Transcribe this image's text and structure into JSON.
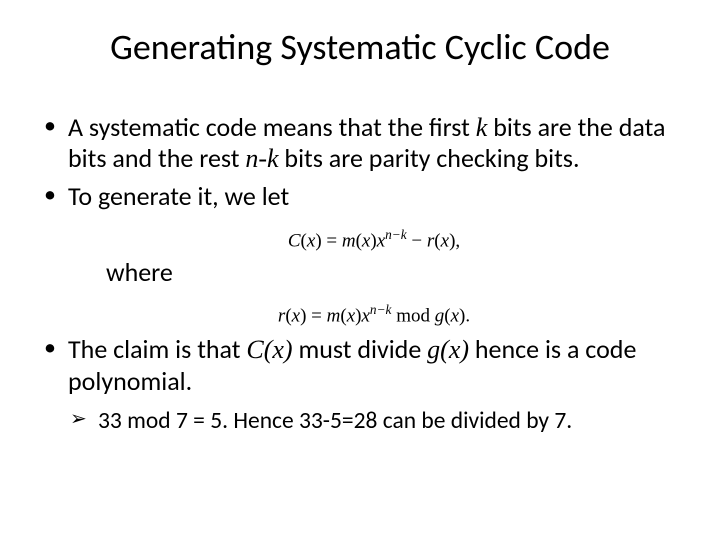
{
  "title": "Generating Systematic Cyclic Code",
  "bullets": {
    "b1_pre": "A systematic code means that the first ",
    "b1_k": "k",
    "b1_mid": " bits are the data bits and the rest ",
    "b1_nk": "n-k",
    "b1_post": " bits are parity checking bits.",
    "b2": "To generate it, we let",
    "b3_pre": "The claim is that ",
    "b3_cx": "C(x)",
    "b3_mid": " must divide ",
    "b3_gx": "g(x)",
    "b3_post": " hence is a code polynomial."
  },
  "eq1": {
    "lhs_var": "C",
    "lhs_arg": "x",
    "eq": " = ",
    "m": "m",
    "xarg": "x",
    "xbase": "x",
    "exp1": "n",
    "exp_minus": "−",
    "exp2": "k",
    "minus": " − ",
    "r": "r",
    "comma": ","
  },
  "where": "where",
  "eq2": {
    "r": "r",
    "xarg": "x",
    "eq": " = ",
    "m": "m",
    "xbase": "x",
    "exp1": "n",
    "exp_minus": "−",
    "exp2": "k",
    "mod": " mod ",
    "g": "g",
    "period": "."
  },
  "sub1": "33 mod 7 = 5. Hence 33-5=28 can be divided by 7."
}
